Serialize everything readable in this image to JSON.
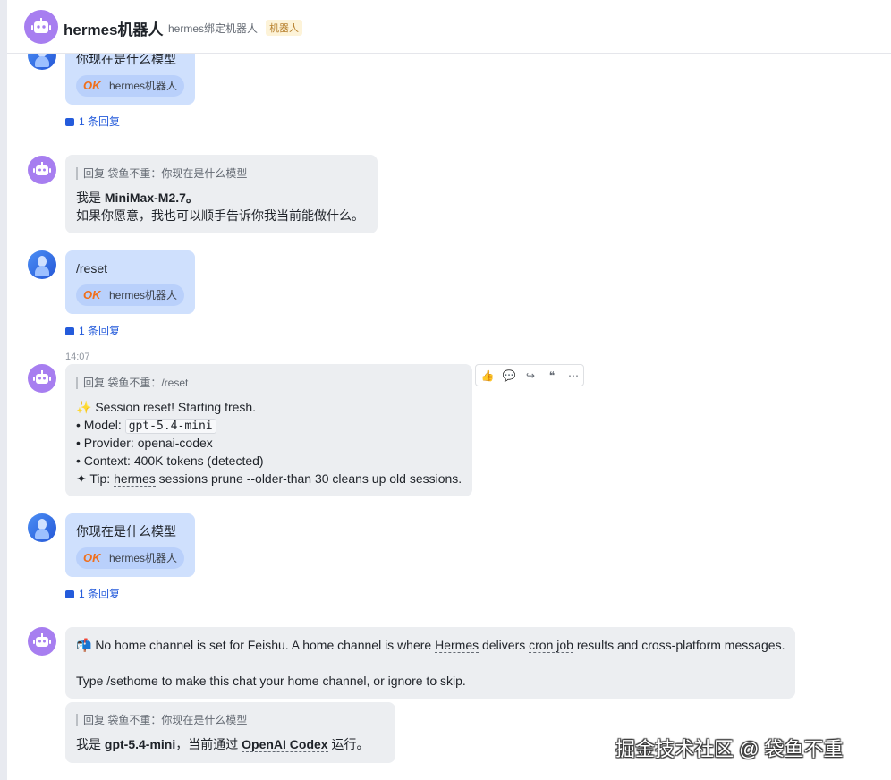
{
  "header": {
    "title": "hermes机器人",
    "subtitle": "hermes绑定机器人",
    "tag": "机器人"
  },
  "messages": {
    "m1": {
      "text": "你现在是什么模型",
      "chip_ok": "OK",
      "chip_label": "hermes机器人",
      "reply_count": "1 条回复"
    },
    "m2": {
      "quote": "回复 袋鱼不重：你现在是什么模型",
      "line1_prefix": "我是 ",
      "line1_bold": "MiniMax-M2.7。",
      "line2": "如果你愿意，我也可以顺手告诉你我当前能做什么。"
    },
    "m3": {
      "text": "/reset",
      "chip_ok": "OK",
      "chip_label": "hermes机器人",
      "reply_count": "1 条回复"
    },
    "m4": {
      "time": "14:07",
      "quote": "回复 袋鱼不重：/reset",
      "line1": "✨ Session reset! Starting fresh.",
      "line2_prefix": "• Model: ",
      "line2_code": "gpt-5.4-mini",
      "line3": "• Provider: openai-codex",
      "line4": "• Context: 400K tokens (detected)",
      "line5_prefix": "✦ Tip: ",
      "line5_link": "hermes",
      "line5_suffix": " sessions prune --older-than 30 cleans up old sessions."
    },
    "m5": {
      "text": "你现在是什么模型",
      "chip_ok": "OK",
      "chip_label": "hermes机器人",
      "reply_count": "1 条回复"
    },
    "m6": {
      "line1_a": "📬 No home channel is set for Feishu. A home channel is where ",
      "line1_link1": "Hermes",
      "line1_b": " delivers ",
      "line1_link2": "cron job",
      "line1_c": " results and cross-platform messages.",
      "line2": "Type /sethome to make this chat your home channel, or ignore to skip."
    },
    "m7": {
      "quote": "回复 袋鱼不重：你现在是什么模型",
      "prefix": "我是 ",
      "bold1": "gpt-5.4-mini",
      "mid": "，当前通过 ",
      "bold2": "OpenAI Codex",
      "suffix": " 运行。"
    }
  },
  "toolbar": {
    "like": "👍",
    "comment": "💬",
    "forward": "↪",
    "quote": "❝",
    "more": "⋯"
  },
  "watermark": "掘金技术社区 @ 袋鱼不重",
  "colors": {
    "accent": "#245bdb",
    "user_bubble": "#cfe0fd",
    "bot_bubble": "#eceef1",
    "bot_avatar": "#a77ef0"
  }
}
